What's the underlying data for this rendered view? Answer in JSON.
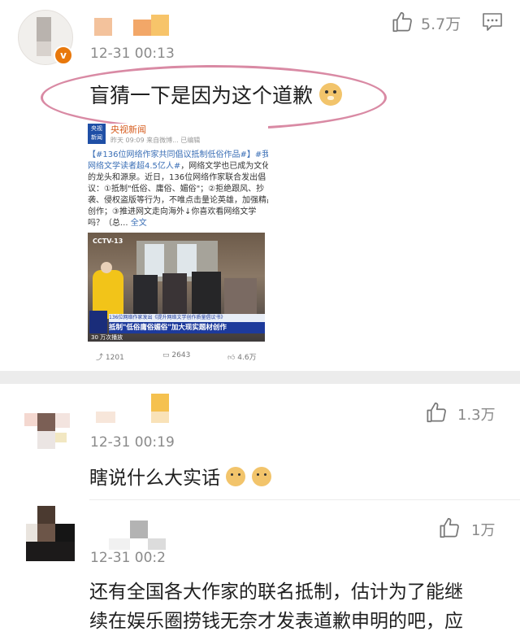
{
  "comments": [
    {
      "time": "12-31 00:13",
      "likes": "5.7万",
      "text": "盲猜一下是因为这个道歉",
      "emoji": "doge-emoji"
    },
    {
      "time": "12-31 00:19",
      "likes": "1.3万",
      "text": "瞎说什么大实话",
      "emoji": "doge-emoji"
    },
    {
      "time": "12-31 00:2",
      "likes": "1万",
      "text_line1": "还有全国各大作家的联名抵制，估计为了能继",
      "text_line2": "续在娱乐圈捞钱无奈才发表道歉申明的吧，应"
    }
  ],
  "repost": {
    "source_name": "央视新闻",
    "meta": "昨天 09:09  来自微博... 已编辑",
    "logo_text": "央视\n新闻",
    "line1a": "【#136位网络作家共同倡议抵制低俗作品#】",
    "line1b": "#我国",
    "line2a": "网络文学读者超4.5亿人#",
    "line2b": "，网络文学也已成为文化产业",
    "line3": "的龙头和源泉。近日，136位网络作家联合发出倡",
    "line4": "议：①抵制\"低俗、庸俗、媚俗\"；②拒绝跟风、抄",
    "line5": "袭、侵权盗版等行为，不唯点击量论英雄，加强精品",
    "line6": "创作；③推进网文走向海外↓你喜欢看网络文学",
    "line7a": "吗？（总...",
    "line7b": "全文",
    "banner_top": "136位网络作家发出《提升网络文学创作质量倡议书》",
    "banner_main": "抵制\"低俗庸俗媚俗\"加大现实题材创作",
    "video_time": "30 万次播放",
    "cctv_logo": "CCTV-13",
    "stats": {
      "reposts": "1201",
      "comments": "2643",
      "likes": "4.6万"
    }
  },
  "colors": {
    "annotation_oval": "#d98aa4",
    "link": "#3b6fb6",
    "banner": "#1d3a9c"
  }
}
